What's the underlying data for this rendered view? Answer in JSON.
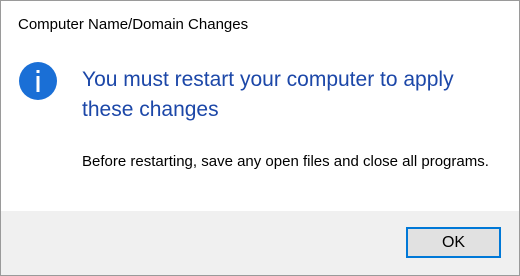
{
  "dialog": {
    "title": "Computer Name/Domain Changes",
    "heading": "You must restart your computer to apply these changes",
    "body": "Before restarting, save any open files and close all programs.",
    "icon": "info-icon",
    "ok_label": "OK"
  },
  "colors": {
    "heading": "#1c47a8",
    "icon": "#1a6fd6",
    "footer": "#f0f0f0",
    "button_border": "#0078d7"
  }
}
